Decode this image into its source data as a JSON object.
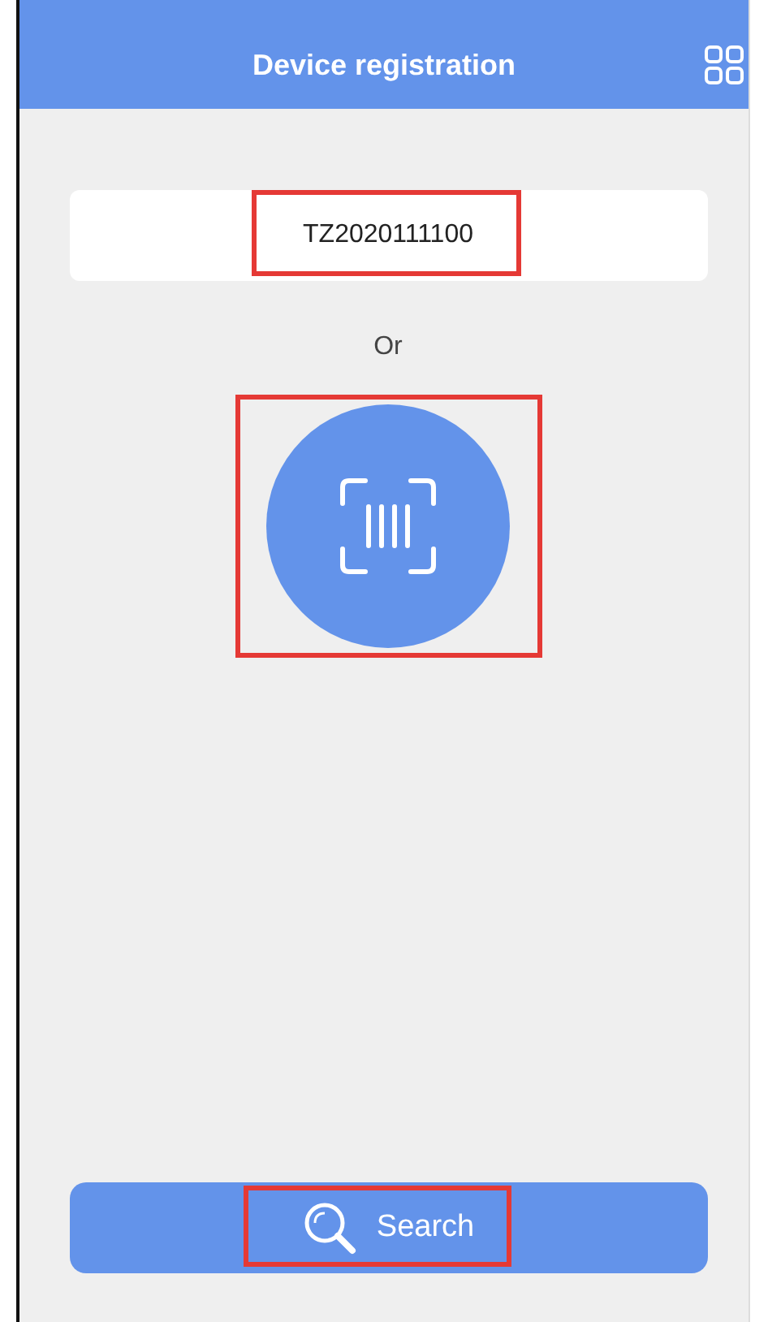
{
  "header": {
    "title": "Device registration"
  },
  "device_field": {
    "value": "TZ2020111100",
    "highlighted": true
  },
  "separator": "Or",
  "scan_button": {
    "highlighted": true
  },
  "search_button": {
    "label": "Search",
    "highlighted": true
  }
}
